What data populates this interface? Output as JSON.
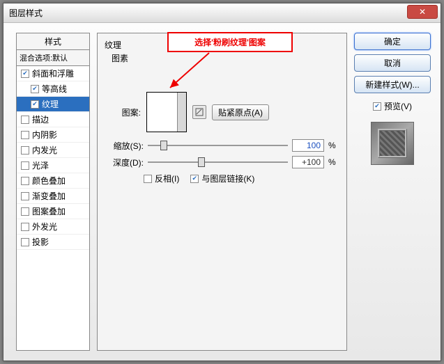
{
  "window": {
    "title": "图层样式"
  },
  "close": {
    "glyph": "✕"
  },
  "left": {
    "header": "样式",
    "sub": "混合选项:默认",
    "items": [
      {
        "label": "斜面和浮雕",
        "checked": true,
        "selected": false,
        "child": false
      },
      {
        "label": "等高线",
        "checked": true,
        "selected": false,
        "child": true
      },
      {
        "label": "纹理",
        "checked": true,
        "selected": true,
        "child": true
      },
      {
        "label": "描边",
        "checked": false,
        "selected": false,
        "child": false
      },
      {
        "label": "内阴影",
        "checked": false,
        "selected": false,
        "child": false
      },
      {
        "label": "内发光",
        "checked": false,
        "selected": false,
        "child": false
      },
      {
        "label": "光泽",
        "checked": false,
        "selected": false,
        "child": false
      },
      {
        "label": "颜色叠加",
        "checked": false,
        "selected": false,
        "child": false
      },
      {
        "label": "渐变叠加",
        "checked": false,
        "selected": false,
        "child": false
      },
      {
        "label": "图案叠加",
        "checked": false,
        "selected": false,
        "child": false
      },
      {
        "label": "外发光",
        "checked": false,
        "selected": false,
        "child": false
      },
      {
        "label": "投影",
        "checked": false,
        "selected": false,
        "child": false
      }
    ]
  },
  "mid": {
    "group": "纹理",
    "subgroup": "图素",
    "pattern_label": "图案:",
    "snap_btn": "贴紧原点(A)",
    "scale_label": "缩放(S):",
    "scale_value": "100",
    "scale_unit": "%",
    "depth_label": "深度(D):",
    "depth_value": "+100",
    "depth_unit": "%",
    "invert_label": "反相(I)",
    "link_label": "与图层链接(K)",
    "invert_checked": false,
    "link_checked": true
  },
  "callout": {
    "text": "选择'粉刷纹理'图案"
  },
  "right": {
    "ok": "确定",
    "cancel": "取消",
    "new_style": "新建样式(W)...",
    "preview_label": "预览(V)",
    "preview_checked": true
  }
}
